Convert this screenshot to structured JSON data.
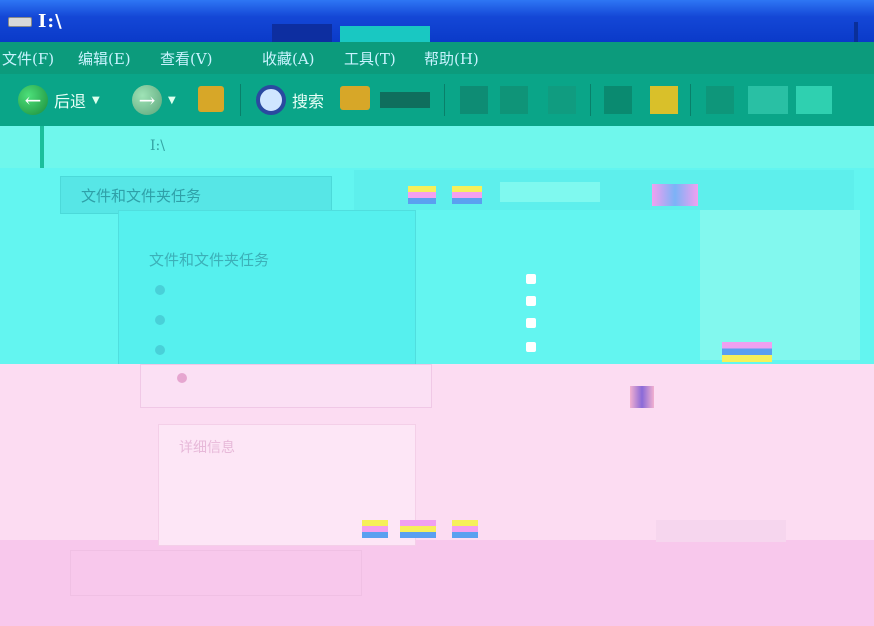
{
  "window": {
    "title": "I:\\"
  },
  "menubar": {
    "items": [
      {
        "label": "文件(F)"
      },
      {
        "label": "编辑(E)"
      },
      {
        "label": "查看(V)"
      },
      {
        "label": "收藏(A)"
      },
      {
        "label": "工具(T)"
      },
      {
        "label": "帮助(H)"
      }
    ]
  },
  "toolbar": {
    "back_label": "后退",
    "search_label": "搜索"
  },
  "address": {
    "value": "I:\\"
  },
  "left_pane": {
    "top_label": "文件和文件夹任务",
    "tasks_header": "文件和文件夹任务",
    "details_header": "详细信息"
  },
  "colors": {
    "titlebar": "#1447d6",
    "menubar": "#0c9b7c",
    "toolbar": "#0aa588",
    "main_cyan": "#63f5f0",
    "pink": "#fcdcf2"
  }
}
